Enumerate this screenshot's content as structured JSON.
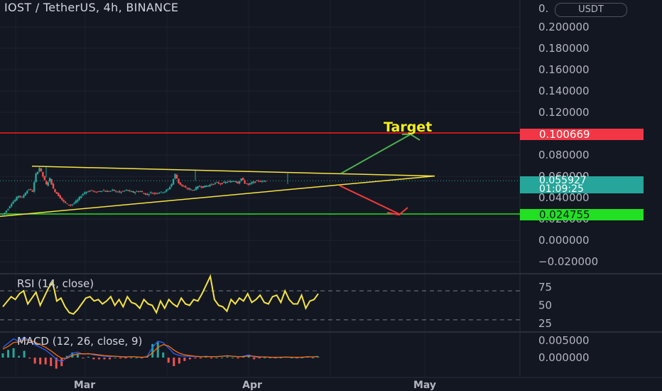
{
  "header": {
    "title": "IOST / TetherUS, 4h, BINANCE",
    "currency": "USDT",
    "top_tick_partial": "0."
  },
  "annotation": {
    "target_label": "Target"
  },
  "price_tags": {
    "resistance": "0.100669",
    "current_price": "0.055927",
    "countdown": "01:09:25",
    "support": "0.024755"
  },
  "colors": {
    "background": "#131722",
    "candle_up": "#26a69a",
    "candle_down": "#ef5350",
    "trendline": "#f5e342",
    "resistance_line": "#ff1a1a",
    "support_line": "#22e022",
    "up_arrow": "#4caf50",
    "down_arrow": "#f23b3b",
    "target_text": "#f5ee1a",
    "current_tag": "#26a69a",
    "rsi_line": "#f5e342",
    "macd_line": "#2962ff",
    "signal_line": "#ff6d00"
  },
  "panes": {
    "rsi": {
      "label": "RSI (14, close)"
    },
    "macd": {
      "label": "MACD (12, 26, close, 9)"
    }
  },
  "chart_data": [
    {
      "type": "candlestick",
      "title": "IOST / TetherUS, 4h, BINANCE",
      "x_ticks": [
        "Mar",
        "Apr",
        "May"
      ],
      "y_ticks": [
        "0.200000",
        "0.180000",
        "0.160000",
        "0.140000",
        "0.120000",
        "0.080000",
        "0.060000",
        "0.040000",
        "0.020000",
        "0.000000",
        "−0.020000"
      ],
      "y_range": [
        -0.024,
        0.212
      ],
      "grid": true,
      "close_path": [
        0.024,
        0.026,
        0.03,
        0.035,
        0.038,
        0.042,
        0.04,
        0.045,
        0.048,
        0.046,
        0.062,
        0.068,
        0.06,
        0.052,
        0.058,
        0.048,
        0.044,
        0.04,
        0.036,
        0.034,
        0.033,
        0.035,
        0.038,
        0.042,
        0.045,
        0.046,
        0.047,
        0.045,
        0.046,
        0.047,
        0.046,
        0.046,
        0.047,
        0.046,
        0.045,
        0.046,
        0.047,
        0.046,
        0.045,
        0.046,
        0.046,
        0.044,
        0.043,
        0.045,
        0.044,
        0.045,
        0.045,
        0.046,
        0.048,
        0.053,
        0.062,
        0.054,
        0.051,
        0.049,
        0.048,
        0.047,
        0.049,
        0.051,
        0.05,
        0.051,
        0.052,
        0.053,
        0.054,
        0.053,
        0.054,
        0.055,
        0.055,
        0.056,
        0.054,
        0.058,
        0.054,
        0.052,
        0.054,
        0.055,
        0.056,
        0.055,
        0.056
      ],
      "horizontal_levels": [
        {
          "name": "resistance",
          "value": 0.100669
        },
        {
          "name": "support",
          "value": 0.024755
        },
        {
          "name": "current",
          "value": 0.055927
        }
      ],
      "triangle": {
        "upper": [
          {
            "i": 8,
            "y": 0.0695
          },
          {
            "i": 122,
            "y": 0.0603
          }
        ],
        "lower": [
          {
            "i": 0,
            "y": 0.0225
          },
          {
            "i": 122,
            "y": 0.0603
          }
        ]
      },
      "arrows": [
        {
          "name": "breakout-up",
          "from": [
            95.5,
            0.0605
          ],
          "to": [
            115.5,
            0.0995
          ]
        },
        {
          "name": "breakdown",
          "from": [
            95.5,
            0.0555
          ],
          "to": [
            112.5,
            0.024
          ]
        }
      ]
    },
    {
      "type": "line",
      "title": "RSI (14, close)",
      "y_ticks": [
        "75",
        "50",
        "25"
      ],
      "y_range": [
        8,
        92
      ],
      "levels": [
        70,
        30
      ],
      "values": [
        48,
        55,
        62,
        58,
        66,
        70,
        52,
        60,
        68,
        50,
        62,
        74,
        82,
        56,
        60,
        48,
        40,
        38,
        44,
        52,
        60,
        62,
        56,
        58,
        52,
        56,
        62,
        50,
        58,
        48,
        62,
        54,
        52,
        46,
        58,
        52,
        50,
        40,
        56,
        46,
        58,
        52,
        48,
        60,
        52,
        50,
        58,
        56,
        66,
        78,
        90,
        58,
        50,
        48,
        42,
        58,
        52,
        60,
        56,
        66,
        54,
        58,
        64,
        54,
        52,
        62,
        64,
        54,
        70,
        58,
        52,
        52,
        64,
        46,
        56,
        58,
        66
      ]
    },
    {
      "type": "line",
      "title": "MACD (12, 26, close, 9)",
      "y_ticks": [
        "0.005000",
        "0.000000"
      ],
      "y_range": [
        -0.0032,
        0.0078
      ],
      "series": [
        {
          "name": "MACD",
          "values": [
            0.003,
            0.0042,
            0.0055,
            0.0048,
            0.006,
            0.005,
            0.0038,
            0.003,
            0.0022,
            0.001,
            -0.0005,
            -0.0012,
            0.0,
            0.0012,
            0.0016,
            0.001,
            0.0012,
            0.0008,
            0.0006,
            0.0004,
            0.0003,
            0.0004,
            0.0002,
            0.0001,
            0.0003,
            0.0002,
            0.0,
            0.0004,
            0.003,
            0.0048,
            0.0044,
            0.0028,
            0.0012,
            0.0006,
            0.0004,
            0.0004,
            0.0003,
            0.0002,
            0.0004,
            0.0002,
            0.0003,
            0.0004,
            0.0006,
            0.0004,
            0.0002,
            0.0004,
            0.0008,
            0.0002,
            0.0001,
            0.0002,
            0.0001,
            0.0,
            0.0001,
            0.0002,
            0.0001,
            0.0,
            0.0001,
            0.0003,
            0.0002,
            0.0004
          ]
        },
        {
          "name": "Signal",
          "values": [
            0.0025,
            0.0033,
            0.0044,
            0.0046,
            0.0052,
            0.0051,
            0.0045,
            0.0038,
            0.003,
            0.002,
            0.0008,
            -0.0002,
            -0.0002,
            0.0006,
            0.0011,
            0.0011,
            0.0011,
            0.001,
            0.0008,
            0.0006,
            0.0005,
            0.0004,
            0.0003,
            0.0002,
            0.0003,
            0.0002,
            0.0001,
            0.0002,
            0.0014,
            0.003,
            0.0038,
            0.0034,
            0.0022,
            0.0013,
            0.0008,
            0.0006,
            0.0004,
            0.0003,
            0.0003,
            0.0003,
            0.0003,
            0.0004,
            0.0005,
            0.0004,
            0.0003,
            0.0003,
            0.0005,
            0.0004,
            0.0002,
            0.0002,
            0.0001,
            0.0001,
            0.0001,
            0.0001,
            0.0001,
            0.0001,
            0.0001,
            0.0002,
            0.0002,
            0.0003
          ]
        }
      ]
    }
  ]
}
